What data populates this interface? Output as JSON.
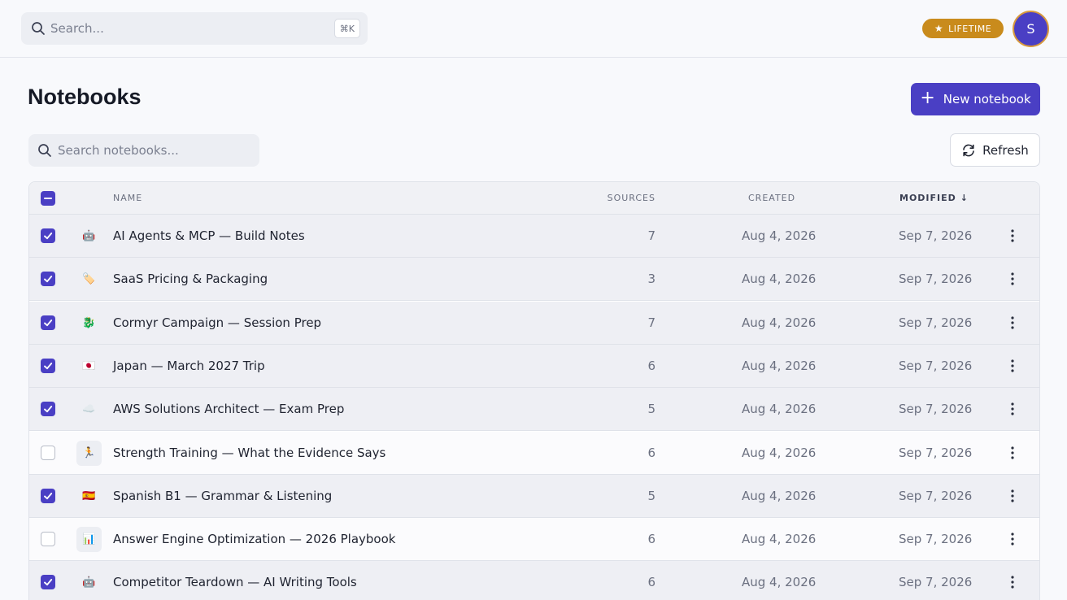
{
  "topbar": {
    "search_placeholder": "Search...",
    "shortcut": "⌘K",
    "plan_badge": "LIFETIME",
    "avatar_initial": "S"
  },
  "page": {
    "title": "Notebooks",
    "new_button": "New notebook",
    "search_placeholder": "Search notebooks...",
    "refresh_button": "Refresh"
  },
  "table": {
    "headers": {
      "name": "NAME",
      "sources": "SOURCES",
      "created": "CREATED",
      "modified": "MODIFIED"
    },
    "sort": {
      "column": "modified",
      "direction": "desc",
      "icon": "arrow-down-icon"
    },
    "rows": [
      {
        "icon": "🤖",
        "name": "AI Agents & MCP — Build Notes",
        "sources": "7",
        "created": "Aug 4, 2026",
        "modified": "Sep 7, 2026",
        "selected": true
      },
      {
        "icon": "🏷️",
        "name": "SaaS Pricing & Packaging",
        "sources": "3",
        "created": "Aug 4, 2026",
        "modified": "Sep 7, 2026",
        "selected": true
      },
      {
        "icon": "🐉",
        "name": "Cormyr Campaign — Session Prep",
        "sources": "7",
        "created": "Aug 4, 2026",
        "modified": "Sep 7, 2026",
        "selected": true
      },
      {
        "icon": "🇯🇵",
        "name": "Japan — March 2027 Trip",
        "sources": "6",
        "created": "Aug 4, 2026",
        "modified": "Sep 7, 2026",
        "selected": true
      },
      {
        "icon": "☁️",
        "name": "AWS Solutions Architect — Exam Prep",
        "sources": "5",
        "created": "Aug 4, 2026",
        "modified": "Sep 7, 2026",
        "selected": true
      },
      {
        "icon": "🏃",
        "name": "Strength Training — What the Evidence Says",
        "sources": "6",
        "created": "Aug 4, 2026",
        "modified": "Sep 7, 2026",
        "selected": false
      },
      {
        "icon": "🇪🇸",
        "name": "Spanish B1 — Grammar & Listening",
        "sources": "5",
        "created": "Aug 4, 2026",
        "modified": "Sep 7, 2026",
        "selected": true
      },
      {
        "icon": "📊",
        "name": "Answer Engine Optimization — 2026 Playbook",
        "sources": "6",
        "created": "Aug 4, 2026",
        "modified": "Sep 7, 2026",
        "selected": false
      },
      {
        "icon": "🤖",
        "name": "Competitor Teardown — AI Writing Tools",
        "sources": "6",
        "created": "Aug 4, 2026",
        "modified": "Sep 7, 2026",
        "selected": true
      }
    ]
  },
  "colors": {
    "accent": "#4a3fc4",
    "badge": "#c98b1c",
    "avatar_ring": "#d89a3e"
  }
}
